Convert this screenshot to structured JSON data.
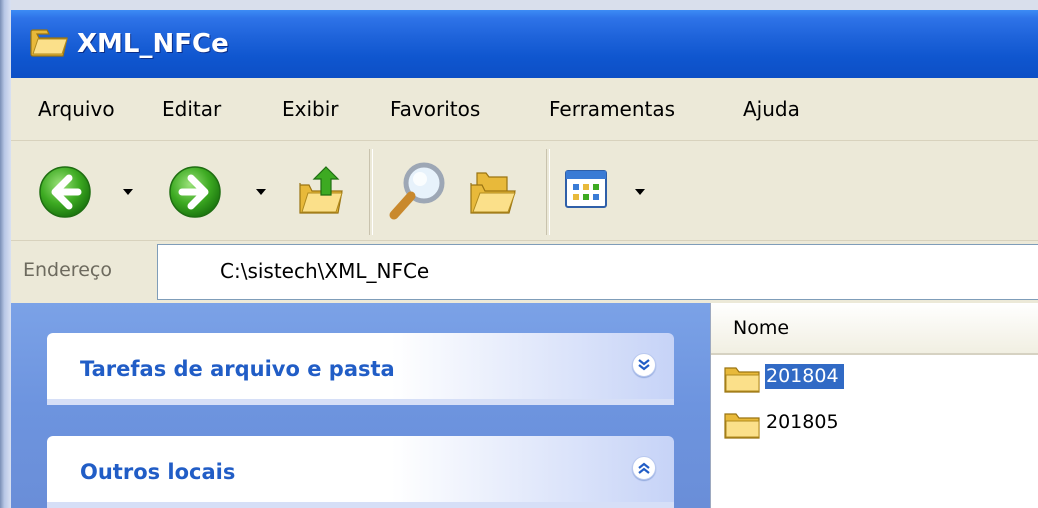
{
  "window": {
    "title": "XML_NFCe"
  },
  "menu": [
    "Arquivo",
    "Editar",
    "Exibir",
    "Favoritos",
    "Ferramentas",
    "Ajuda"
  ],
  "toolbar": {
    "buttons": [
      "back-arrow-icon",
      "forward-arrow-icon",
      "up-folder-icon",
      "search-icon",
      "folders-icon",
      "views-icon"
    ]
  },
  "address": {
    "label": "Endereço",
    "value": "C:\\sistech\\XML_NFCe"
  },
  "task_pane": {
    "panels": [
      {
        "title": "Tarefas de arquivo e pasta",
        "state": "collapsed"
      },
      {
        "title": "Outros locais",
        "state": "expanded"
      }
    ]
  },
  "file_list": {
    "column": "Nome",
    "items": [
      {
        "name": "201804",
        "selected": true
      },
      {
        "name": "201805",
        "selected": false
      }
    ]
  }
}
